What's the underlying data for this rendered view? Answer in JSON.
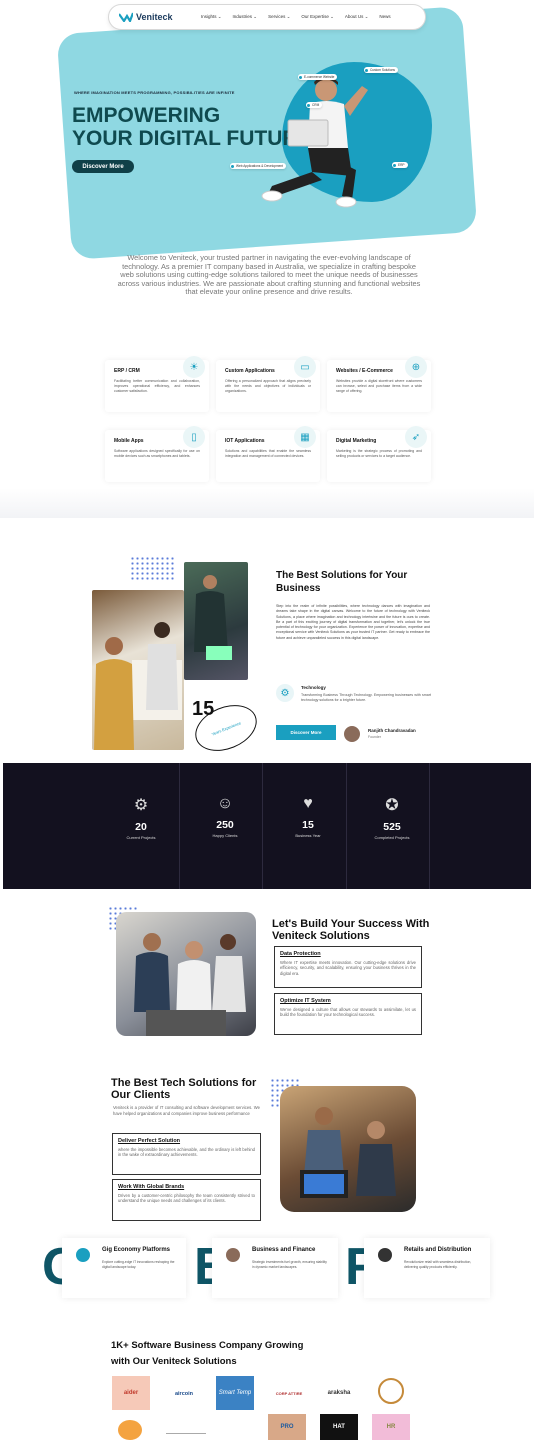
{
  "nav": {
    "brand": "Veniteck",
    "brand_sub": "SOLUTIONS",
    "links": [
      "Insights ⌄",
      "Industries ⌄",
      "Services ⌄",
      "Our Expertise ⌄",
      "About Us ⌄",
      "News"
    ]
  },
  "hero": {
    "tagline": "WHERE IMAGINATION MEETS PROGRAMMING, POSSIBILITIES ARE INFINITE",
    "title_line1": "EMPOWERING",
    "title_line2": "YOUR DIGITAL FUTURE",
    "cta": "Discover More",
    "chips": [
      "E-commerce Website",
      "Custom Solutions",
      "CRM",
      "Web Applications & Development",
      "ERP"
    ]
  },
  "intro": "Welcome to Veniteck, your trusted partner in navigating the ever-evolving landscape of technology. As a premier IT company based in Australia, we specialize in crafting bespoke web solutions using cutting-edge solutions tailored to meet the unique needs of businesses across various industries. We are passionate about crafting stunning and functional websites that elevate your online presence and drive results.",
  "services": [
    {
      "title": "ERP / CRM",
      "text": "Facilitating better communication and collaboration, improves operational efficiency, and enhances customer satisfaction.",
      "icon": "bulb-icon"
    },
    {
      "title": "Custom Applications",
      "text": "Offering a personalized approach that aligns precisely with the needs and objectives of individuals or organizations.",
      "icon": "laptop-icon"
    },
    {
      "title": "Websites / E-Commerce",
      "text": "Websites provide a digital storefront where customers can browse, select and purchase items from a wide range of offering.",
      "icon": "cart-icon"
    },
    {
      "title": "Mobile Apps",
      "text": "Software applications designed specifically for use on mobile devices such as smartphones and tablets.",
      "icon": "mobile-icon"
    },
    {
      "title": "IOT Applications",
      "text": "Solutions and capabilities that enable the seamless integration and management of connected devices.",
      "icon": "iot-icon"
    },
    {
      "title": "Digital Marketing",
      "text": "Marketing is the strategic process of promoting and selling products or services to a target audience.",
      "icon": "rocket-icon"
    }
  ],
  "best": {
    "title": "The Best Solutions for Your Business",
    "text": "Step into the realm of infinite possibilities, where technology dances with imagination and dreams take shape in the digital canvas. Welcome to the future of technology with Veniteck Solutions, a place where imagination and technology intertwine and the future is ours to create. Be a part of this exciting journey of digital transformation and together, let's unlock the true potential of technology for your organization. Experience the power of innovation, expertise and exceptional service with Veniteck Solutions as your trusted IT partner. Get ready to embrace the future and achieve unparalleled success in this digital landscape.",
    "tech_title": "Technology",
    "tech_text": "Transforming Business Through Technology. Empowering businesses with smart technology solutions for a brighter future.",
    "cta": "Discover More",
    "founder_name": "Ranjith Chandravadan",
    "founder_role": "Founder",
    "years_num": "15",
    "years_label": "Years Experience"
  },
  "stats": [
    {
      "num": "20",
      "label": "Current Projects",
      "icon": "gear-icon"
    },
    {
      "num": "250",
      "label": "Happy Clients",
      "icon": "person-icon"
    },
    {
      "num": "15",
      "label": "Business Year",
      "icon": "hands-icon"
    },
    {
      "num": "525",
      "label": "Completed Projects",
      "icon": "award-icon"
    }
  ],
  "build": {
    "title": "Let's Build Your Success With Veniteck Solutions",
    "items": [
      {
        "title": "Data Protection",
        "text": "Where IT expertise meets innovation. Our cutting-edge solutions drive efficiency, security, and scalability, ensuring your business thrives in the digital era."
      },
      {
        "title": "Optimize IT System",
        "text": "We've designed a culture that allows our stewards to assimilate, let us build the foundation for your technological success."
      }
    ]
  },
  "tech": {
    "title": "The Best Tech Solutions for Our Clients",
    "text": "Veniteck is a provider of IT consulting and software development services. We have helped organizations and companies improve business performance",
    "items": [
      {
        "title": "Deliver Perfect Solution",
        "text": "where the impossible becomes achievable, and the ordinary is left behind in the wake of extraordinary achievements."
      },
      {
        "title": "Work With Global Brands",
        "text": "Driven by a customer-centric philosophy the team consistently strived to understand the unique needs and challenges of its clients."
      }
    ]
  },
  "cards": [
    {
      "letter": "G",
      "title": "Gig Economy Platforms",
      "text": "Explore cutting-edge IT innovations reshaping the digital landscape today."
    },
    {
      "letter": "B",
      "title": "Business and Finance",
      "text": "Strategic investments fuel growth, ensuring stability in dynamic market landscapes."
    },
    {
      "letter": "R",
      "title": "Retails and Distribution",
      "text": "Revolutionize retail with seamless distribution, delivering quality products efficiently."
    }
  ],
  "growing": {
    "line1": "1K+ Software Business Company Growing",
    "line2": "with Our Veniteck Solutions"
  },
  "client_logos": [
    "aider",
    "aircoin",
    "Smart Temp",
    "CORP ATTIRE",
    "araksha",
    "",
    "",
    "",
    "",
    "PRO",
    "HAT",
    "HR"
  ]
}
